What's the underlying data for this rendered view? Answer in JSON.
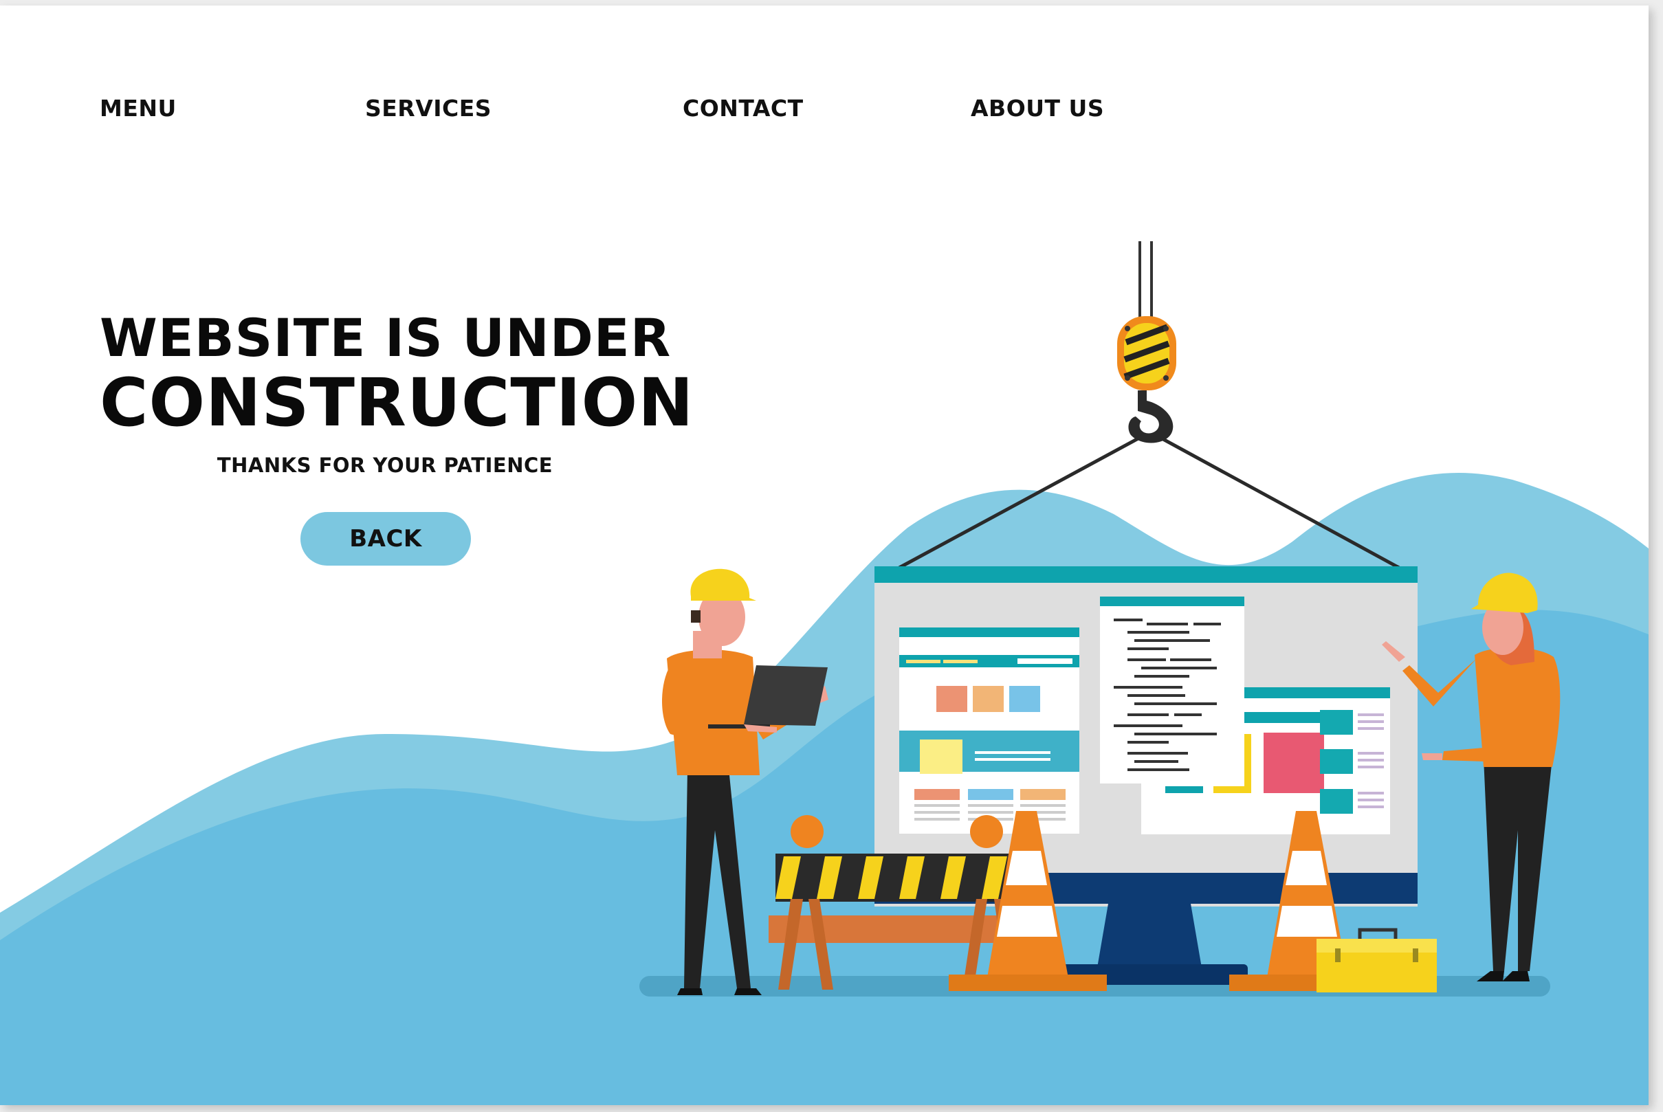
{
  "nav": {
    "items": [
      {
        "label": "MENU"
      },
      {
        "label": "SERVICES"
      },
      {
        "label": "CONTACT"
      },
      {
        "label": "ABOUT US"
      }
    ]
  },
  "hero": {
    "title_line1": "WEBSITE IS UNDER",
    "title_line2": "CONSTRUCTION",
    "subtitle": "THANKS FOR YOUR PATIENCE",
    "back_label": "BACK"
  },
  "colors": {
    "accent": "#7cc7e0",
    "wave_light": "#84cbe3",
    "wave_dark": "#67bde0",
    "worker_shirt": "#ef8420",
    "helmet": "#f6d21c",
    "monitor_header": "#0ea3ad",
    "monitor_base": "#0d3b73"
  }
}
